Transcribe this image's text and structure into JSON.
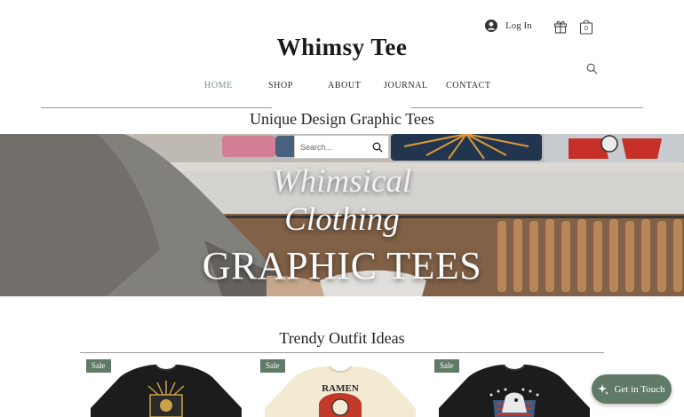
{
  "header": {
    "login_label": "Log In",
    "cart_count": "0",
    "brand": "Whimsy Tee"
  },
  "nav": {
    "items": [
      {
        "label": "HOME",
        "active": true
      },
      {
        "label": "SHOP",
        "active": false
      },
      {
        "label": "ABOUT",
        "active": false
      },
      {
        "label": "JOURNAL",
        "active": false
      },
      {
        "label": "CONTACT",
        "active": false
      }
    ]
  },
  "tagline": "Unique Design Graphic Tees",
  "hero": {
    "search_placeholder": "Search...",
    "line1": "Whimsical",
    "line2": "Clothing",
    "line3": "GRAPHIC TEES"
  },
  "section": {
    "title": "Trendy Outfit Ideas"
  },
  "products": [
    {
      "badge": "Sale",
      "shirt_color": "#1c1c1c",
      "graphic": "sunburst print"
    },
    {
      "badge": "Sale",
      "shirt_color": "#f2ead2",
      "graphic_text": "RAMEN"
    },
    {
      "badge": "Sale",
      "shirt_color": "#1c1c1c",
      "graphic": "eagle flag print"
    }
  ],
  "chat": {
    "label": "Get in Touch"
  },
  "colors": {
    "accent": "#5f7a66",
    "nav_active": "#7a8a7e"
  }
}
